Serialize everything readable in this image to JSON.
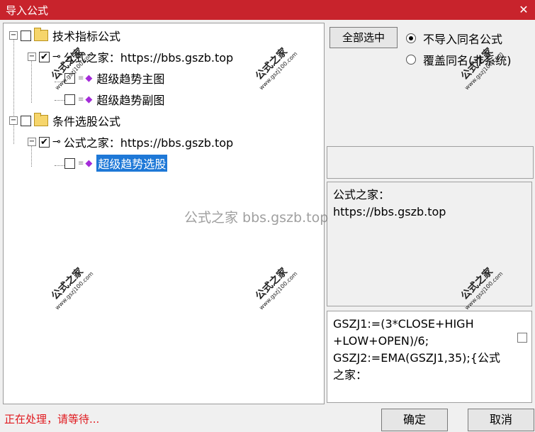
{
  "window": {
    "title": "导入公式",
    "close": "✕"
  },
  "tree": {
    "group1": {
      "label": "技术指标公式",
      "expander": "−",
      "checked": false
    },
    "source1": {
      "label": "公式之家：https://bbs.gszb.top",
      "expander": "−",
      "checked": true
    },
    "item1": {
      "label": "超级趋势主图",
      "checked": false
    },
    "item2": {
      "label": "超级趋势副图",
      "checked": false
    },
    "group2": {
      "label": "条件选股公式",
      "expander": "−",
      "checked": false
    },
    "source2": {
      "label": "公式之家：https://bbs.gszb.top",
      "expander": "−",
      "checked": true
    },
    "item3": {
      "label": "超级趋势选股",
      "checked": false,
      "selected": true
    }
  },
  "options": {
    "select_all": "全部选中",
    "radio1": {
      "label": "不导入同名公式",
      "selected": true
    },
    "radio2": {
      "label": "覆盖同名(非系统)",
      "selected": false
    }
  },
  "info": {
    "line1": "公式之家：",
    "line2": "https://bbs.gszb.top"
  },
  "code": {
    "text": "GSZJ1:=(3*CLOSE+HIGH\n+LOW+OPEN)/6;\nGSZJ2:=EMA(GSZJ1,35);{公式\n之家："
  },
  "status": "正在处理，请等待...",
  "buttons": {
    "ok": "确定",
    "cancel": "取消"
  },
  "watermarks": {
    "main": "公式之家",
    "url": "www.gszj100.com",
    "center": "公式之家 bbs.gszb.top"
  }
}
